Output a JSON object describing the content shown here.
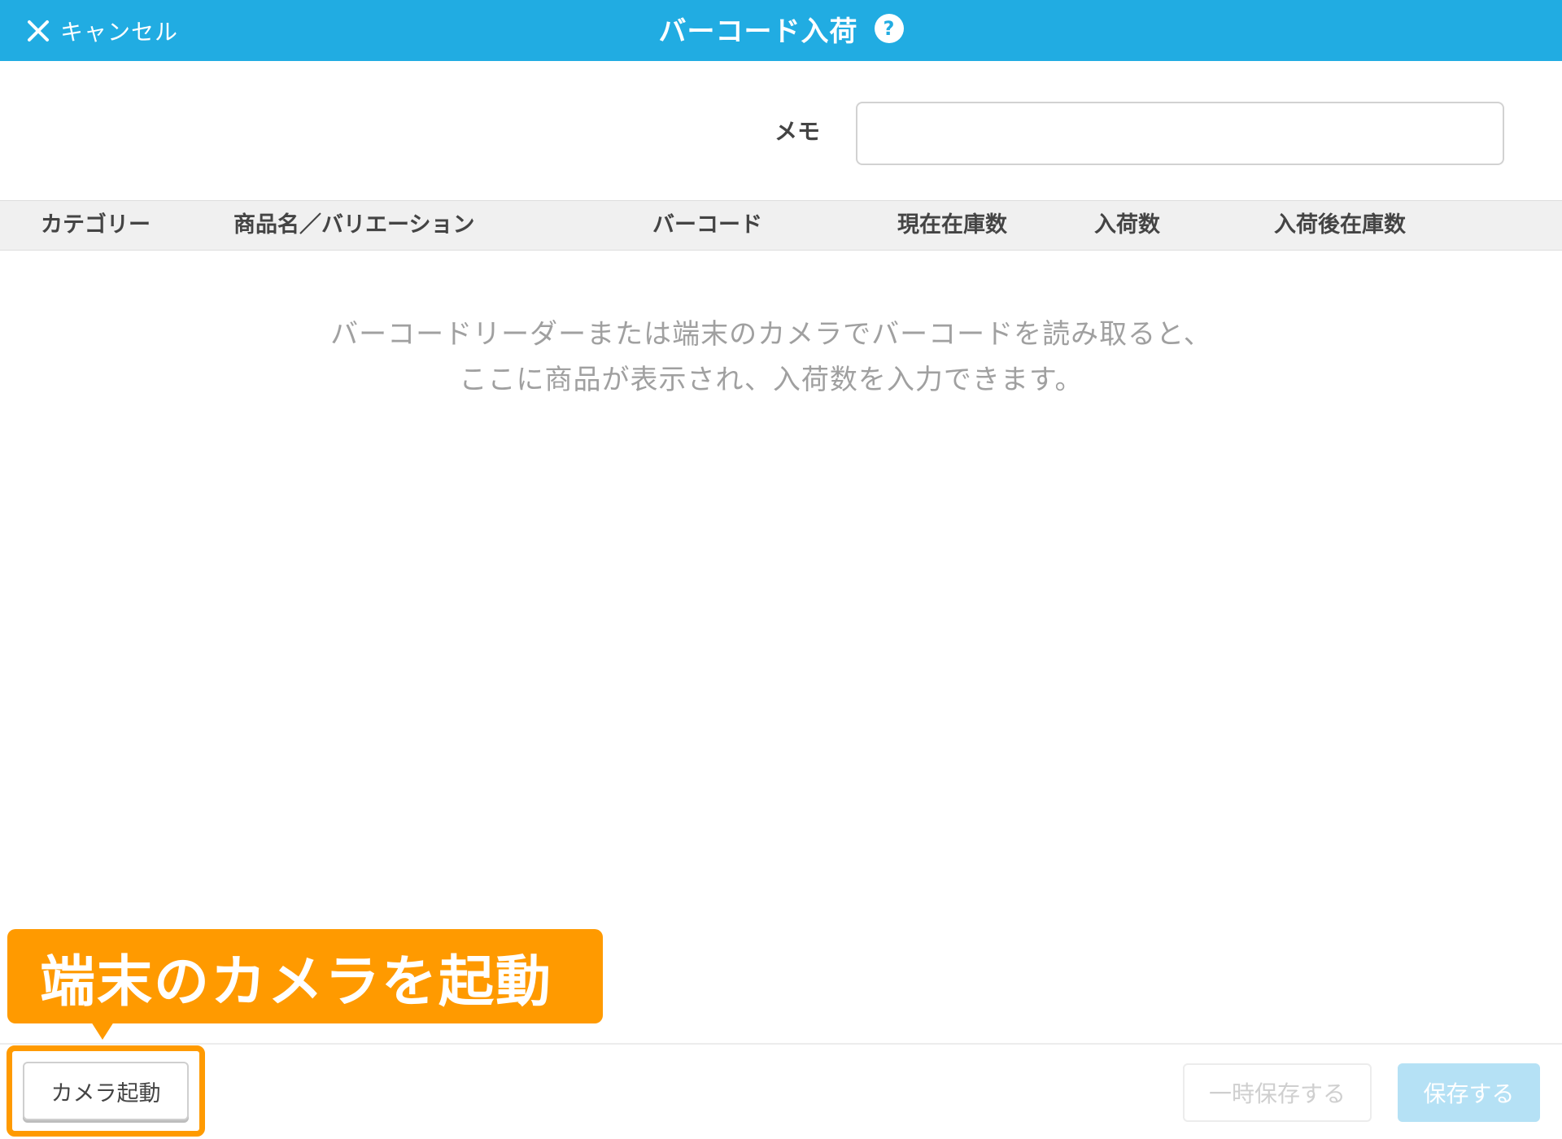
{
  "header": {
    "cancel_label": "キャンセル",
    "cancel_icon": "close-icon",
    "title": "バーコード入荷",
    "help_icon_glyph": "?",
    "background_color": "#21ace2"
  },
  "memo": {
    "label": "メモ",
    "value": ""
  },
  "table": {
    "columns": [
      "カテゴリー",
      "商品名／バリエーション",
      "バーコード",
      "現在在庫数",
      "入荷数",
      "入荷後在庫数"
    ]
  },
  "empty_message": {
    "line1": "バーコードリーダーまたは端末のカメラでバーコードを読み取ると、",
    "line2": "ここに商品が表示され、入荷数を入力できます。"
  },
  "callout": {
    "text": "端末のカメラを起動",
    "color": "#ff9a00"
  },
  "footer": {
    "camera_button_label": "カメラ起動",
    "temp_save_label": "一時保存する",
    "save_label": "保存する"
  }
}
